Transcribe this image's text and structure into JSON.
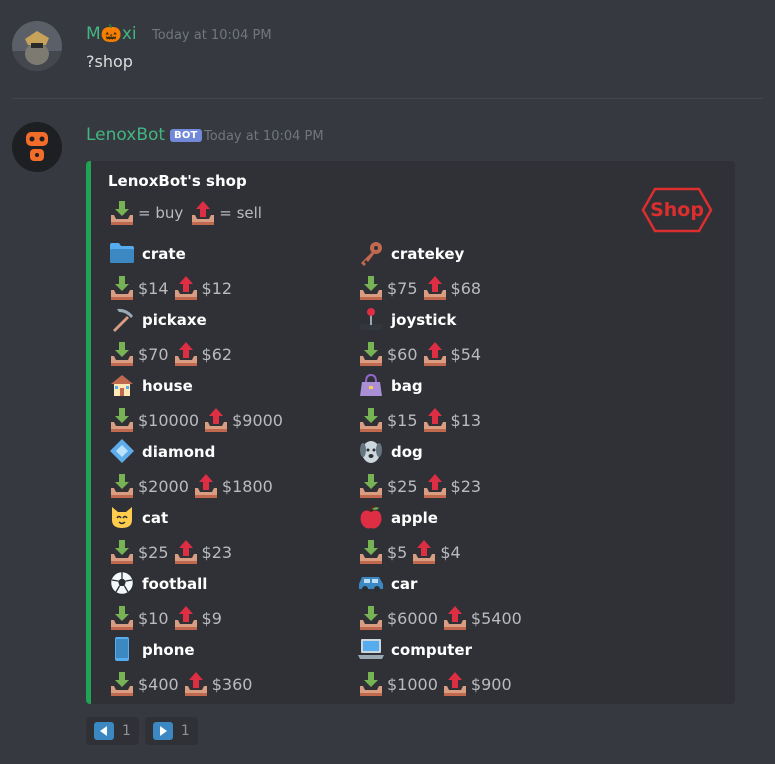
{
  "messages": [
    {
      "author": "M🎃xi",
      "author_color": "#43b581",
      "timestamp": "Today at 10:04 PM",
      "content": "?shop",
      "avatar": "cat-with-hat-avatar"
    },
    {
      "author": "LenoxBot",
      "author_color": "#43b581",
      "badge": "BOT",
      "timestamp": "Today at 10:04 PM",
      "avatar": "robot-avatar"
    }
  ],
  "embed": {
    "title": "LenoxBot's shop",
    "legend_buy": "= buy",
    "legend_sell": "= sell",
    "thumbnail_text": "Shop",
    "accent": "#21a356",
    "items": [
      {
        "name": "crate",
        "emoji": "folder-icon",
        "buy": "$14",
        "sell": "$12"
      },
      {
        "name": "cratekey",
        "emoji": "key-icon",
        "buy": "$75",
        "sell": "$68"
      },
      {
        "name": "pickaxe",
        "emoji": "pickaxe-icon",
        "buy": "$70",
        "sell": "$62"
      },
      {
        "name": "joystick",
        "emoji": "joystick-icon",
        "buy": "$60",
        "sell": "$54"
      },
      {
        "name": "house",
        "emoji": "house-icon",
        "buy": "$10000",
        "sell": "$9000"
      },
      {
        "name": "bag",
        "emoji": "handbag-icon",
        "buy": "$15",
        "sell": "$13"
      },
      {
        "name": "diamond",
        "emoji": "diamond-icon",
        "buy": "$2000",
        "sell": "$1800"
      },
      {
        "name": "dog",
        "emoji": "dog-icon",
        "buy": "$25",
        "sell": "$23"
      },
      {
        "name": "cat",
        "emoji": "cat-icon",
        "buy": "$25",
        "sell": "$23"
      },
      {
        "name": "apple",
        "emoji": "apple-icon",
        "buy": "$5",
        "sell": "$4"
      },
      {
        "name": "football",
        "emoji": "soccer-ball-icon",
        "buy": "$10",
        "sell": "$9"
      },
      {
        "name": "car",
        "emoji": "car-icon",
        "buy": "$6000",
        "sell": "$5400"
      },
      {
        "name": "phone",
        "emoji": "phone-icon",
        "buy": "$400",
        "sell": "$360"
      },
      {
        "name": "computer",
        "emoji": "laptop-icon",
        "buy": "$1000",
        "sell": "$900"
      }
    ]
  },
  "reactions": [
    {
      "emoji": "arrow-left-icon",
      "count": "1"
    },
    {
      "emoji": "arrow-right-icon",
      "count": "1"
    }
  ]
}
